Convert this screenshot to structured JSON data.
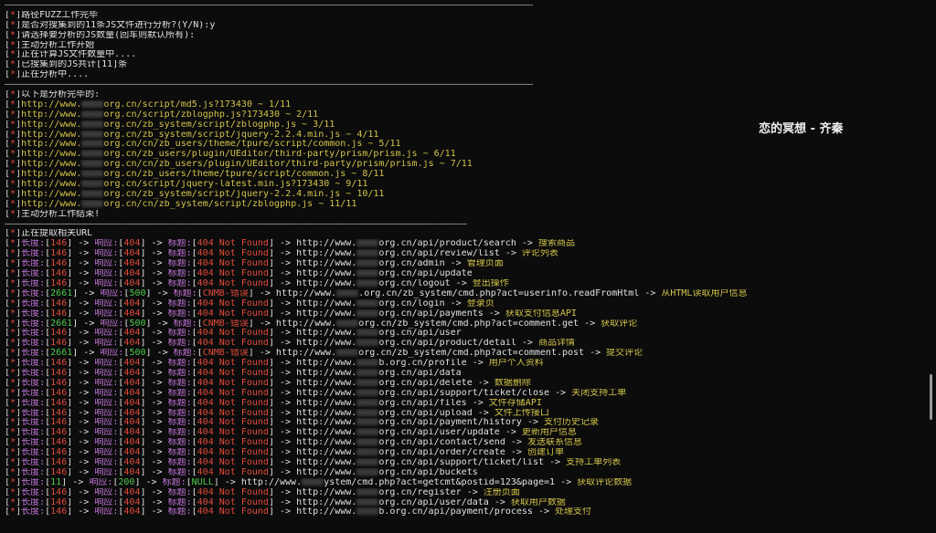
{
  "separator": "————————————————————————————————————————————————————————————————————————————————————————————————",
  "separator_short": "————————————————————————————————————————————————————————————————————————————————————",
  "tag": "[*]",
  "header_lines": [
    "路径FUZZ工作完毕",
    "是否对搜集到的11条JS文件进行分析?(Y/N):y",
    "请选择要分析的JS数量(回车则默认所有):",
    "主动分析工作开始",
    "正在计算JS文件数量中....",
    "已搜集到的JS共计[11]条",
    "正在分析中...."
  ],
  "analysis_title": "以下是分析完毕的:",
  "js_prefix": "http://www.",
  "js_files": [
    {
      "tail": "org.cn/script/md5.js?173430 ~ 1/11"
    },
    {
      "tail": "org.cn/script/zblogphp.js?173430 ~ 2/11"
    },
    {
      "tail": "org.cn/zb_system/script/zblogphp.js ~ 3/11"
    },
    {
      "tail": "org.cn/zb_system/script/jquery-2.2.4.min.js ~ 4/11"
    },
    {
      "tail": "org.cn/cn/zb_users/theme/tpure/script/common.js ~ 5/11"
    },
    {
      "tail": "org.cn/zb_users/plugin/UEditor/third-party/prism/prism.js ~ 6/11"
    },
    {
      "tail": "org.cn/cn/zb_users/plugin/UEditor/third-party/prism/prism.js ~ 7/11"
    },
    {
      "tail": "org.cn/zb_users/theme/tpure/script/common.js ~ 8/11"
    },
    {
      "tail": "org.cn/script/jquery-latest.min.js?173430 ~ 9/11"
    },
    {
      "tail": "org.cn/zb_system/script/jquery-2.2.4.min.js ~ 10/11"
    },
    {
      "tail": "org.cn/cn/zb_system/script/zblogphp.js ~ 11/11"
    }
  ],
  "analysis_end": "主动分析工作结束!",
  "extract_title": "正在提取相关URL",
  "labels": {
    "length": "长度:",
    "response": "响应:",
    "title": "标题:",
    "arrow": " -> "
  },
  "url_prefix": "http://www.",
  "results": [
    {
      "len": "146",
      "code": "404",
      "title": "404 Not Found",
      "tail": "org.cn/api/product/search",
      "desc": "搜索商品"
    },
    {
      "len": "146",
      "code": "404",
      "title": "404 Not Found",
      "tail": "org.cn/api/review/list",
      "desc": "评论列表"
    },
    {
      "len": "146",
      "code": "404",
      "title": "404 Not Found",
      "tail": "org.cn/admin",
      "desc": "管理页面"
    },
    {
      "len": "146",
      "code": "404",
      "title": "404 Not Found",
      "tail": "org.cn/api/update",
      "desc": ""
    },
    {
      "len": "146",
      "code": "404",
      "title": "404 Not Found",
      "tail": "org.cn/logout",
      "desc": "登出操作"
    },
    {
      "len": "2661",
      "code": "500",
      "title": "CNMB-错误",
      "tail": ".org.cn/zb_system/cmd.php?act=userinfo.readFromHtml",
      "desc": "从HTML读取用户信息"
    },
    {
      "len": "146",
      "code": "404",
      "title": "404 Not Found",
      "tail": "org.cn/login",
      "desc": "登录页"
    },
    {
      "len": "146",
      "code": "404",
      "title": "404 Not Found",
      "tail": "org.cn/api/payments",
      "desc": "获取支付信息API"
    },
    {
      "len": "2661",
      "code": "500",
      "title": "CNMB-错误",
      "tail": "org.cn/zb_system/cmd.php?act=comment.get",
      "desc": "获取评论"
    },
    {
      "len": "146",
      "code": "404",
      "title": "404 Not Found",
      "tail": "org.cn/api/user",
      "desc": ""
    },
    {
      "len": "146",
      "code": "404",
      "title": "404 Not Found",
      "tail": "org.cn/api/product/detail",
      "desc": "商品详情"
    },
    {
      "len": "2661",
      "code": "500",
      "title": "CNMB-错误",
      "tail": "org.cn/zb_system/cmd.php?act=comment.post",
      "desc": "提交评论"
    },
    {
      "len": "146",
      "code": "404",
      "title": "404 Not Found",
      "tail": "b.org.cn/profile",
      "desc": "用户个人资料"
    },
    {
      "len": "146",
      "code": "404",
      "title": "404 Not Found",
      "tail": "org.cn/api/data",
      "desc": ""
    },
    {
      "len": "146",
      "code": "404",
      "title": "404 Not Found",
      "tail": "org.cn/api/delete",
      "desc": "数据删除"
    },
    {
      "len": "146",
      "code": "404",
      "title": "404 Not Found",
      "tail": "org.cn/api/support/ticket/close",
      "desc": "关闭支持工单"
    },
    {
      "len": "146",
      "code": "404",
      "title": "404 Not Found",
      "tail": "org.cn/api/files",
      "desc": "文件存储API"
    },
    {
      "len": "146",
      "code": "404",
      "title": "404 Not Found",
      "tail": "org.cn/api/upload",
      "desc": "文件上传接口"
    },
    {
      "len": "146",
      "code": "404",
      "title": "404 Not Found",
      "tail": "org.cn/api/payment/history",
      "desc": "支付历史记录"
    },
    {
      "len": "146",
      "code": "404",
      "title": "404 Not Found",
      "tail": "org.cn/api/user/update",
      "desc": "更新用户信息"
    },
    {
      "len": "146",
      "code": "404",
      "title": "404 Not Found",
      "tail": "org.cn/api/contact/send",
      "desc": "发送联系信息"
    },
    {
      "len": "146",
      "code": "404",
      "title": "404 Not Found",
      "tail": "org.cn/api/order/create",
      "desc": "创建订单"
    },
    {
      "len": "146",
      "code": "404",
      "title": "404 Not Found",
      "tail": "org.cn/api/support/ticket/list",
      "desc": "支持工单列表"
    },
    {
      "len": "146",
      "code": "404",
      "title": "404 Not Found",
      "tail": "org.cn/api/buckets",
      "desc": ""
    },
    {
      "len": "11",
      "code": "200",
      "title": "NULL",
      "tail": "ystem/cmd.php?act=getcmt&postid=123&page=1",
      "desc": "获取评论数据"
    },
    {
      "len": "146",
      "code": "404",
      "title": "404 Not Found",
      "tail": "org.cn/register",
      "desc": "注册页面"
    },
    {
      "len": "146",
      "code": "404",
      "title": "404 Not Found",
      "tail": "org.cn/api/user/data",
      "desc": "获取用户数据"
    },
    {
      "len": "146",
      "code": "404",
      "title": "404 Not Found",
      "tail": "b.org.cn/api/payment/process",
      "desc": "处理支付"
    }
  ],
  "watermark": "恋的冥想 - 齐秦"
}
